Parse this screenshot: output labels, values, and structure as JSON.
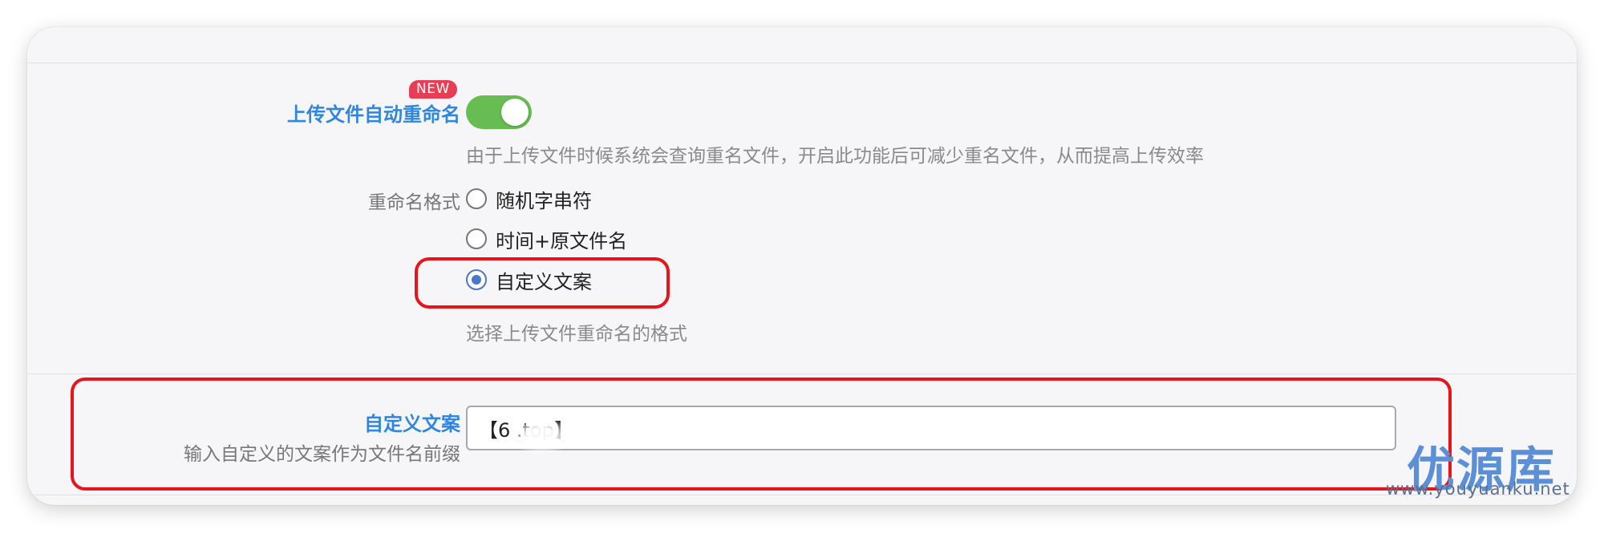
{
  "settings": {
    "auto_rename": {
      "label": "上传文件自动重命名",
      "badge": "NEW",
      "enabled": true,
      "hint": "由于上传文件时候系统会查询重名文件，开启此功能后可减少重名文件，从而提高上传效率"
    },
    "rename_format": {
      "label": "重命名格式",
      "options": [
        {
          "label": "随机字串符",
          "selected": false
        },
        {
          "label": "时间+原文件名",
          "selected": false
        },
        {
          "label": "自定义文案",
          "selected": true
        }
      ],
      "hint": "选择上传文件重命名的格式"
    },
    "custom_text": {
      "label": "自定义文案",
      "sublabel": "输入自定义的文案作为文件名前缀",
      "value": "【6 .top】"
    }
  },
  "watermark": {
    "name": "优源库",
    "url": "www.youyuanku.net"
  },
  "colors": {
    "accent_blue": "#2f86e0",
    "toggle_green": "#67bd52",
    "badge_red": "#e83e55",
    "highlight_red": "#e8141b",
    "radio_blue": "#4a78c6"
  },
  "icons": {
    "toggle": "toggle-switch-on",
    "radio_checked": "radio-checked",
    "radio_unchecked": "radio-unchecked"
  }
}
